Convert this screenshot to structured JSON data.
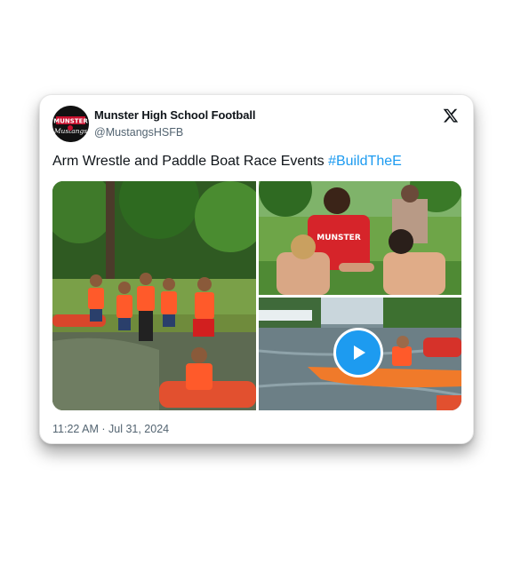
{
  "tweet": {
    "author_name": "Munster High School Football",
    "handle": "@MustangsHSFB",
    "text": "Arm Wrestle and Paddle Boat Race Events ",
    "hashtag": "#BuildTheE",
    "timestamp": "11:22 AM · Jul 31, 2024"
  },
  "avatar": {
    "logo_text_top": "MUNSTER",
    "logo_text_bottom": "Mustangs"
  },
  "shirt_text": "MUNSTER",
  "icons": {
    "platform": "x-logo-icon",
    "video": "play-icon"
  },
  "colors": {
    "link": "#1d9bf0",
    "secondary_text": "#536471",
    "play_button": "#1d9bf0"
  }
}
